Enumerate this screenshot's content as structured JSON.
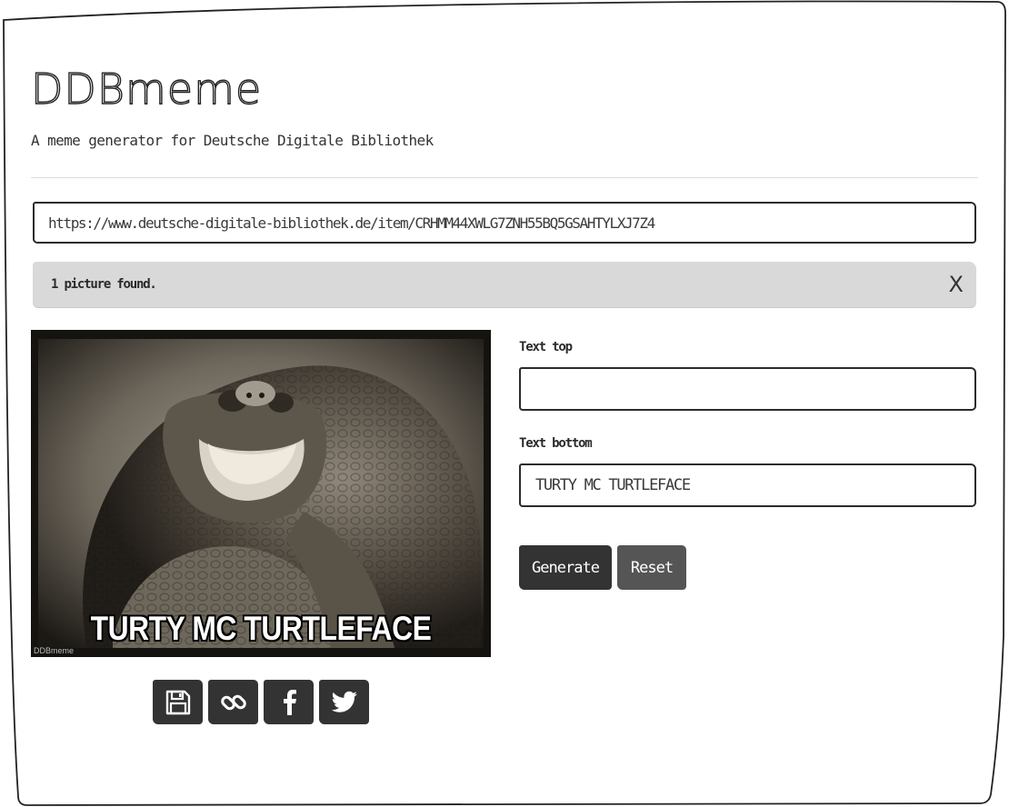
{
  "header": {
    "title": "DDBmeme",
    "subtitle": "A meme generator for Deutsche Digitale Bibliothek"
  },
  "search": {
    "url_value": "https://www.deutsche-digitale-bibliothek.de/item/CRHMM44XWLG7ZNH55BQ5GSAHTYLXJ7Z4"
  },
  "alert": {
    "message": "1 picture found.",
    "close_label": "X"
  },
  "preview": {
    "caption": "TURTY MC TURTLEFACE",
    "watermark": "DDBmeme"
  },
  "share_icons": [
    "save-icon",
    "link-icon",
    "facebook-icon",
    "twitter-icon"
  ],
  "form": {
    "text_top_label": "Text top",
    "text_top_value": "",
    "text_bottom_label": "Text bottom",
    "text_bottom_value": "TURTY MC TURTLEFACE",
    "generate_label": "Generate",
    "reset_label": "Reset"
  },
  "colors": {
    "button_dark": "#333333",
    "button_secondary": "#555555",
    "alert_bg": "#d9d9d9"
  }
}
